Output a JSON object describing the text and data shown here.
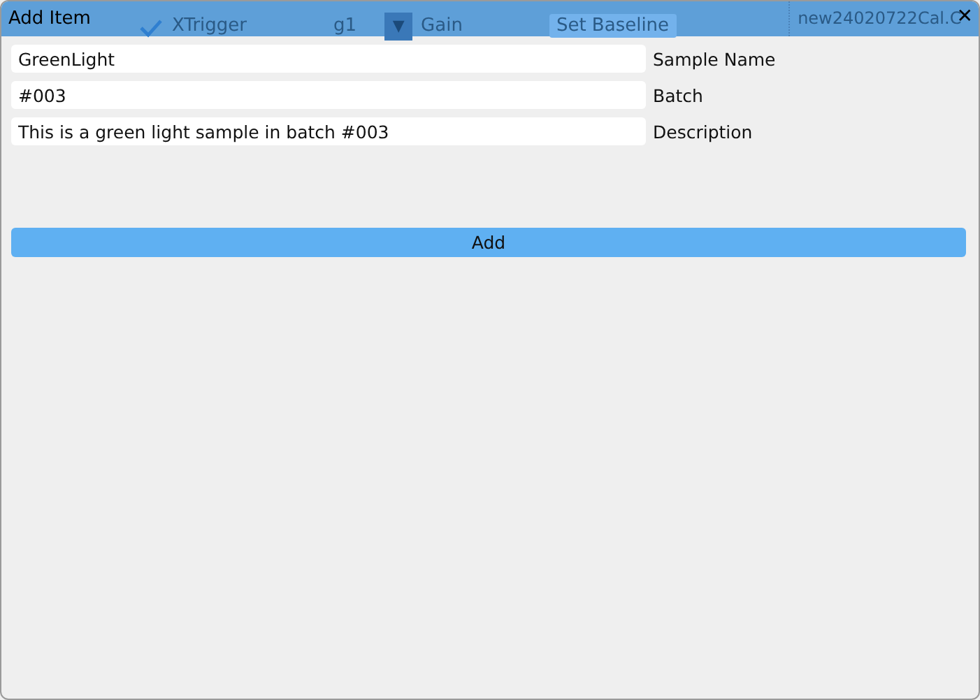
{
  "window": {
    "title": "Add Item",
    "close": "✕"
  },
  "background_toolbar": {
    "xtrigger": {
      "label": "XTrigger",
      "checked": true
    },
    "channel": "g1",
    "gain": {
      "arrow": "▼",
      "label": "Gain"
    },
    "set_baseline": "Set Baseline",
    "file": "new24020722Cal.C"
  },
  "fields": [
    {
      "value": "GreenLight",
      "label": "Sample Name"
    },
    {
      "value": "#003",
      "label": "Batch"
    },
    {
      "value": "This is a green light sample in batch #003",
      "label": "Description"
    }
  ],
  "add_button": "Add"
}
